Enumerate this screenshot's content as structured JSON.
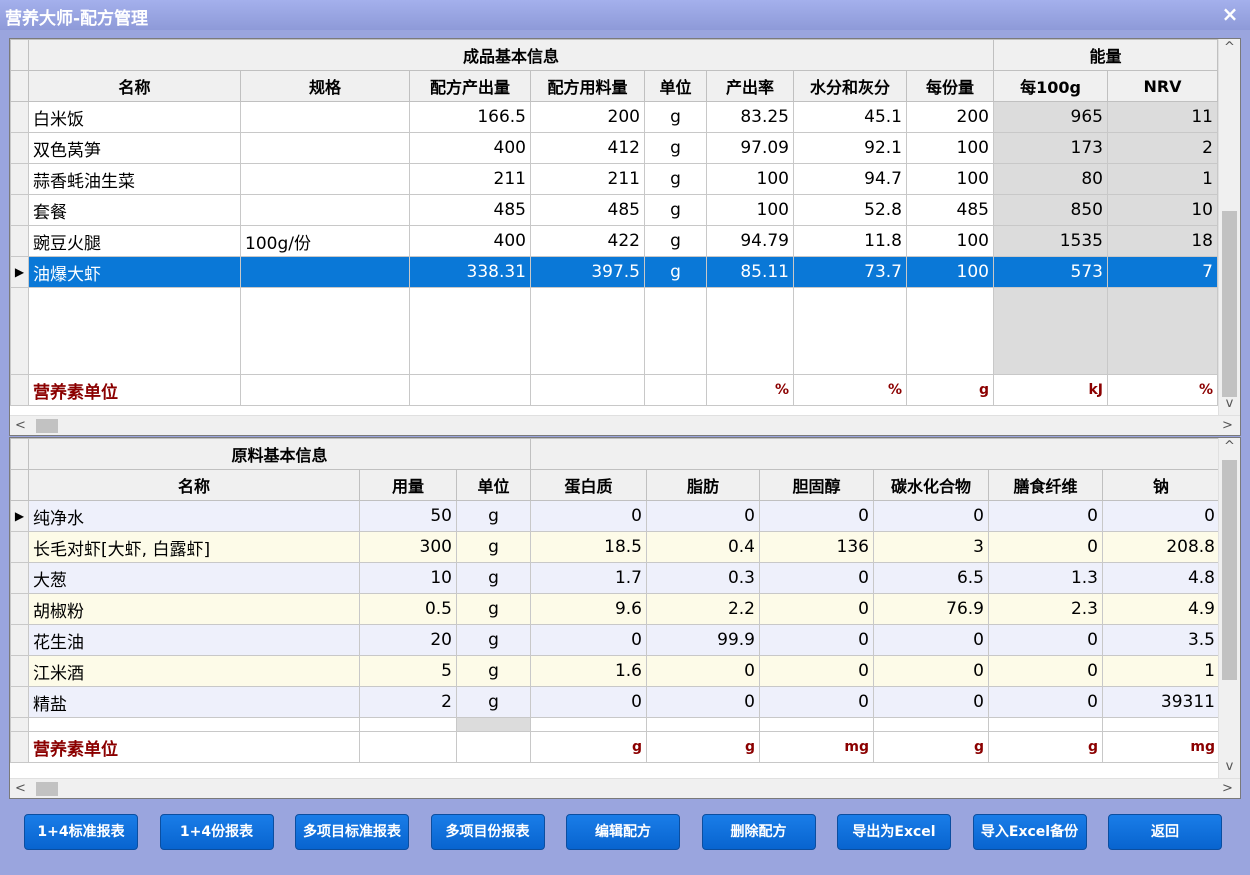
{
  "window": {
    "title": "营养大师-配方管理",
    "close_icon": "×"
  },
  "top": {
    "group_headers": [
      "成品基本信息",
      "能量"
    ],
    "columns": [
      "名称",
      "规格",
      "配方产出量",
      "配方用料量",
      "单位",
      "产出率",
      "水分和灰分",
      "每份量",
      "每100g",
      "NRV"
    ],
    "rows": [
      [
        "白米饭",
        "",
        "166.5",
        "200",
        "g",
        "83.25",
        "45.1",
        "200",
        "965",
        "11"
      ],
      [
        "双色莴笋",
        "",
        "400",
        "412",
        "g",
        "97.09",
        "92.1",
        "100",
        "173",
        "2"
      ],
      [
        "蒜香蚝油生菜",
        "",
        "211",
        "211",
        "g",
        "100",
        "94.7",
        "100",
        "80",
        "1"
      ],
      [
        "套餐",
        "",
        "485",
        "485",
        "g",
        "100",
        "52.8",
        "485",
        "850",
        "10"
      ],
      [
        "豌豆火腿",
        "100g/份",
        "400",
        "422",
        "g",
        "94.79",
        "11.8",
        "100",
        "1535",
        "18"
      ],
      [
        "油爆大虾",
        "",
        "338.31",
        "397.5",
        "g",
        "85.11",
        "73.7",
        "100",
        "573",
        "7"
      ]
    ],
    "unit_row": [
      "营养素单位",
      "",
      "",
      "",
      "",
      "%",
      "%",
      "g",
      "kJ",
      "%"
    ]
  },
  "bottom": {
    "group_header": "原料基本信息",
    "columns": [
      "名称",
      "用量",
      "单位",
      "蛋白质",
      "脂肪",
      "胆固醇",
      "碳水化合物",
      "膳食纤维",
      "钠"
    ],
    "rows": [
      [
        "纯净水",
        "50",
        "g",
        "0",
        "0",
        "0",
        "0",
        "0",
        "0"
      ],
      [
        "长毛对虾[大虾, 白露虾]",
        "300",
        "g",
        "18.5",
        "0.4",
        "136",
        "3",
        "0",
        "208.8"
      ],
      [
        "大葱",
        "10",
        "g",
        "1.7",
        "0.3",
        "0",
        "6.5",
        "1.3",
        "4.8"
      ],
      [
        "胡椒粉",
        "0.5",
        "g",
        "9.6",
        "2.2",
        "0",
        "76.9",
        "2.3",
        "4.9"
      ],
      [
        "花生油",
        "20",
        "g",
        "0",
        "99.9",
        "0",
        "0",
        "0",
        "3.5"
      ],
      [
        "江米酒",
        "5",
        "g",
        "1.6",
        "0",
        "0",
        "0",
        "0",
        "1"
      ],
      [
        "精盐",
        "2",
        "g",
        "0",
        "0",
        "0",
        "0",
        "0",
        "39311"
      ]
    ],
    "unit_row": [
      "营养素单位",
      "",
      "",
      "g",
      "g",
      "mg",
      "g",
      "g",
      "mg"
    ]
  },
  "buttons": [
    "1+4标准报表",
    "1+4份报表",
    "多项目标准报表",
    "多项目份报表",
    "编辑配方",
    "删除配方",
    "导出为Excel",
    "导入Excel备份",
    "返回"
  ],
  "indicator": "▶",
  "scroll": {
    "up": "^",
    "down": "v",
    "left": "<",
    "right": ">"
  }
}
